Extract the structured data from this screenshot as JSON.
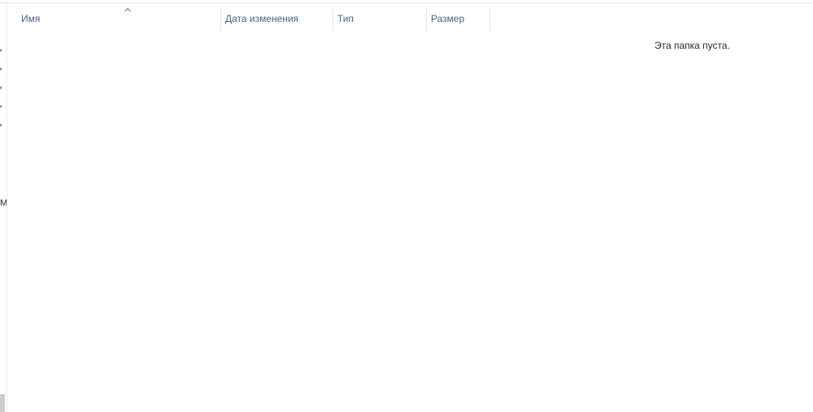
{
  "columns": [
    {
      "id": "name",
      "label": "Имя",
      "sorted": "ascending"
    },
    {
      "id": "date_modified",
      "label": "Дата изменения"
    },
    {
      "id": "type",
      "label": "Тип"
    },
    {
      "id": "size",
      "label": "Размер"
    }
  ],
  "empty_message": "Эта папка пуста.",
  "nav_pane": {
    "clipped_label": "М"
  },
  "icons": {
    "sort_indicator": "chevron-up-icon",
    "nav_expander": "chevron-right-icon"
  },
  "colors": {
    "header_text": "#4c607a",
    "background": "#ffffff"
  }
}
